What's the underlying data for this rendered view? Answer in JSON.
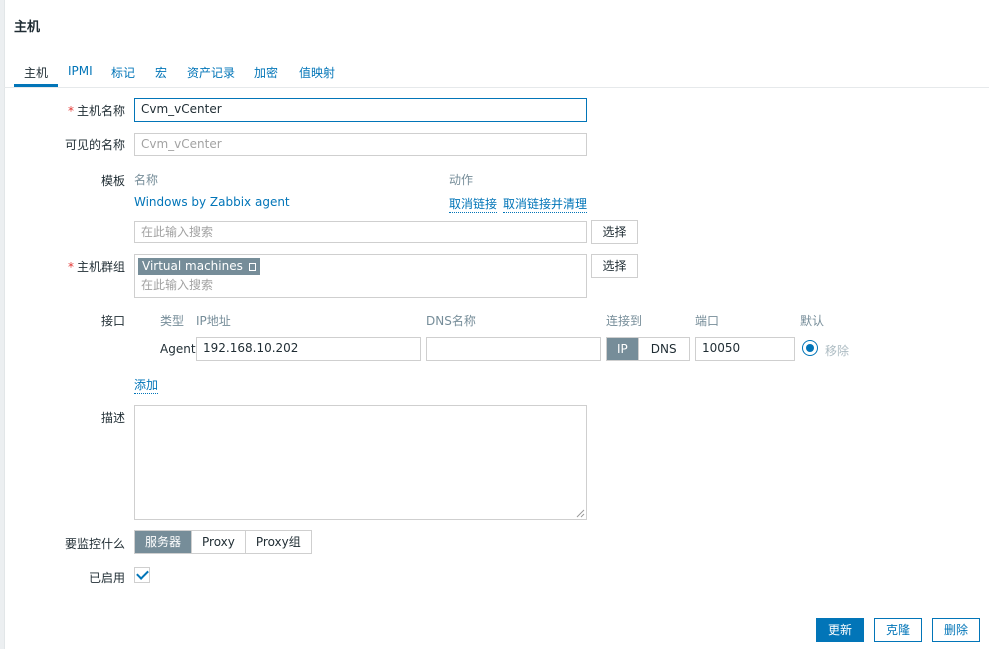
{
  "window": {
    "title": "主机"
  },
  "tabs": [
    {
      "label": "主机"
    },
    {
      "label": "IPMI"
    },
    {
      "label": "标记"
    },
    {
      "label": "宏"
    },
    {
      "label": "资产记录"
    },
    {
      "label": "加密"
    },
    {
      "label": "值映射"
    }
  ],
  "form": {
    "host_name": {
      "label": "主机名称",
      "required_mark": "*",
      "value": "Cvm_vCenter"
    },
    "visible_name": {
      "label": "可见的名称",
      "placeholder": "Cvm_vCenter"
    },
    "templates": {
      "label": "模板",
      "col_name": "名称",
      "col_action": "动作",
      "items": [
        {
          "name": "Windows by Zabbix agent",
          "unlink": "取消链接",
          "unlink_clear": "取消链接并清理"
        }
      ],
      "search_placeholder": "在此输入搜索",
      "select_button": "选择"
    },
    "host_groups": {
      "label": "主机群组",
      "required_mark": "*",
      "tags": [
        "Virtual machines"
      ],
      "search_placeholder": "在此输入搜索",
      "select_button": "选择"
    },
    "interfaces": {
      "label": "接口",
      "headers": {
        "type": "类型",
        "ip": "IP地址",
        "dns": "DNS名称",
        "connect_to": "连接到",
        "port": "端口",
        "default": "默认"
      },
      "rows": [
        {
          "type": "Agent",
          "ip": "192.168.10.202",
          "dns": "",
          "connect_ip": "IP",
          "connect_dns": "DNS",
          "connect_selected": "IP",
          "port": "10050",
          "remove": "移除"
        }
      ],
      "add_link": "添加"
    },
    "description": {
      "label": "描述",
      "value": ""
    },
    "monitored_by": {
      "label": "要监控什么",
      "options": [
        "服务器",
        "Proxy",
        "Proxy组"
      ],
      "selected": "服务器"
    },
    "enabled": {
      "label": "已启用",
      "checked": true
    }
  },
  "actions": {
    "update": "更新",
    "clone": "克隆",
    "delete": "删除"
  },
  "colors": {
    "accent": "#0275b8",
    "required": "#e33734",
    "selected_segment": "#768d99"
  }
}
